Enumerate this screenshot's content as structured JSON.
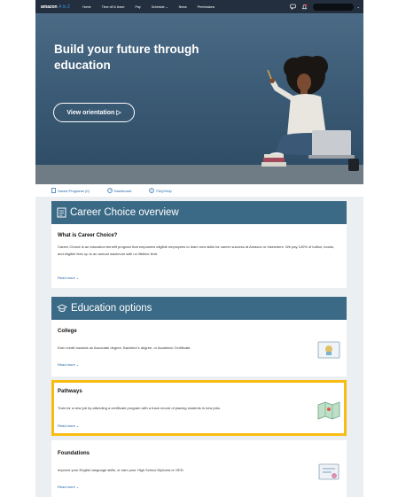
{
  "topnav": {
    "logo": "amazon",
    "logo_suffix": "A to Z",
    "links": [
      "Home",
      "Time off & leave",
      "Pay",
      "Schedule ⌄",
      "News",
      "Permissions"
    ],
    "caret": "⌄"
  },
  "hero": {
    "title": "Build your future through education",
    "button_label": "View orientation ▷"
  },
  "subnav": {
    "items": [
      {
        "label": "Saved Programs (0)",
        "icon": "bookmark-icon"
      },
      {
        "label": "Dashboard",
        "icon": "dashboard-icon"
      },
      {
        "label": "FAQ/Help",
        "icon": "help-icon"
      }
    ]
  },
  "overview": {
    "header": "Career Choice overview",
    "card_title": "What is Career Choice?",
    "text": "Career Choice is an education benefit program that empowers eligible employees to learn new skills for career success at Amazon or elsewhere. We pay 100% of tuition, books, and eligible fees up to an annual maximum with no lifetime limit.",
    "read_more": "Read more ⌄"
  },
  "education": {
    "header": "Education options",
    "options": [
      {
        "title": "College",
        "text": "Earn credit towards an Associate degree, Bachelor's degree, or Academic Certificate.",
        "read_more": "Read more ⌄",
        "icon": "diploma-icon"
      },
      {
        "title": "Pathways",
        "text": "Train for a new job by attending a certificate program with a track record of placing students in new jobs.",
        "read_more": "Read more ⌄",
        "icon": "map-icon"
      },
      {
        "title": "Foundations",
        "text": "Improve your English language skills, or earn your High School Diploma or GED.",
        "read_more": "Read more ⌄",
        "icon": "certificate-icon"
      }
    ]
  },
  "colors": {
    "nav_bg": "#232f3e",
    "hero_bg": "#3c5b76",
    "section_header": "#3b6a86",
    "link": "#1f64a6",
    "highlight": "#f8bc12"
  }
}
